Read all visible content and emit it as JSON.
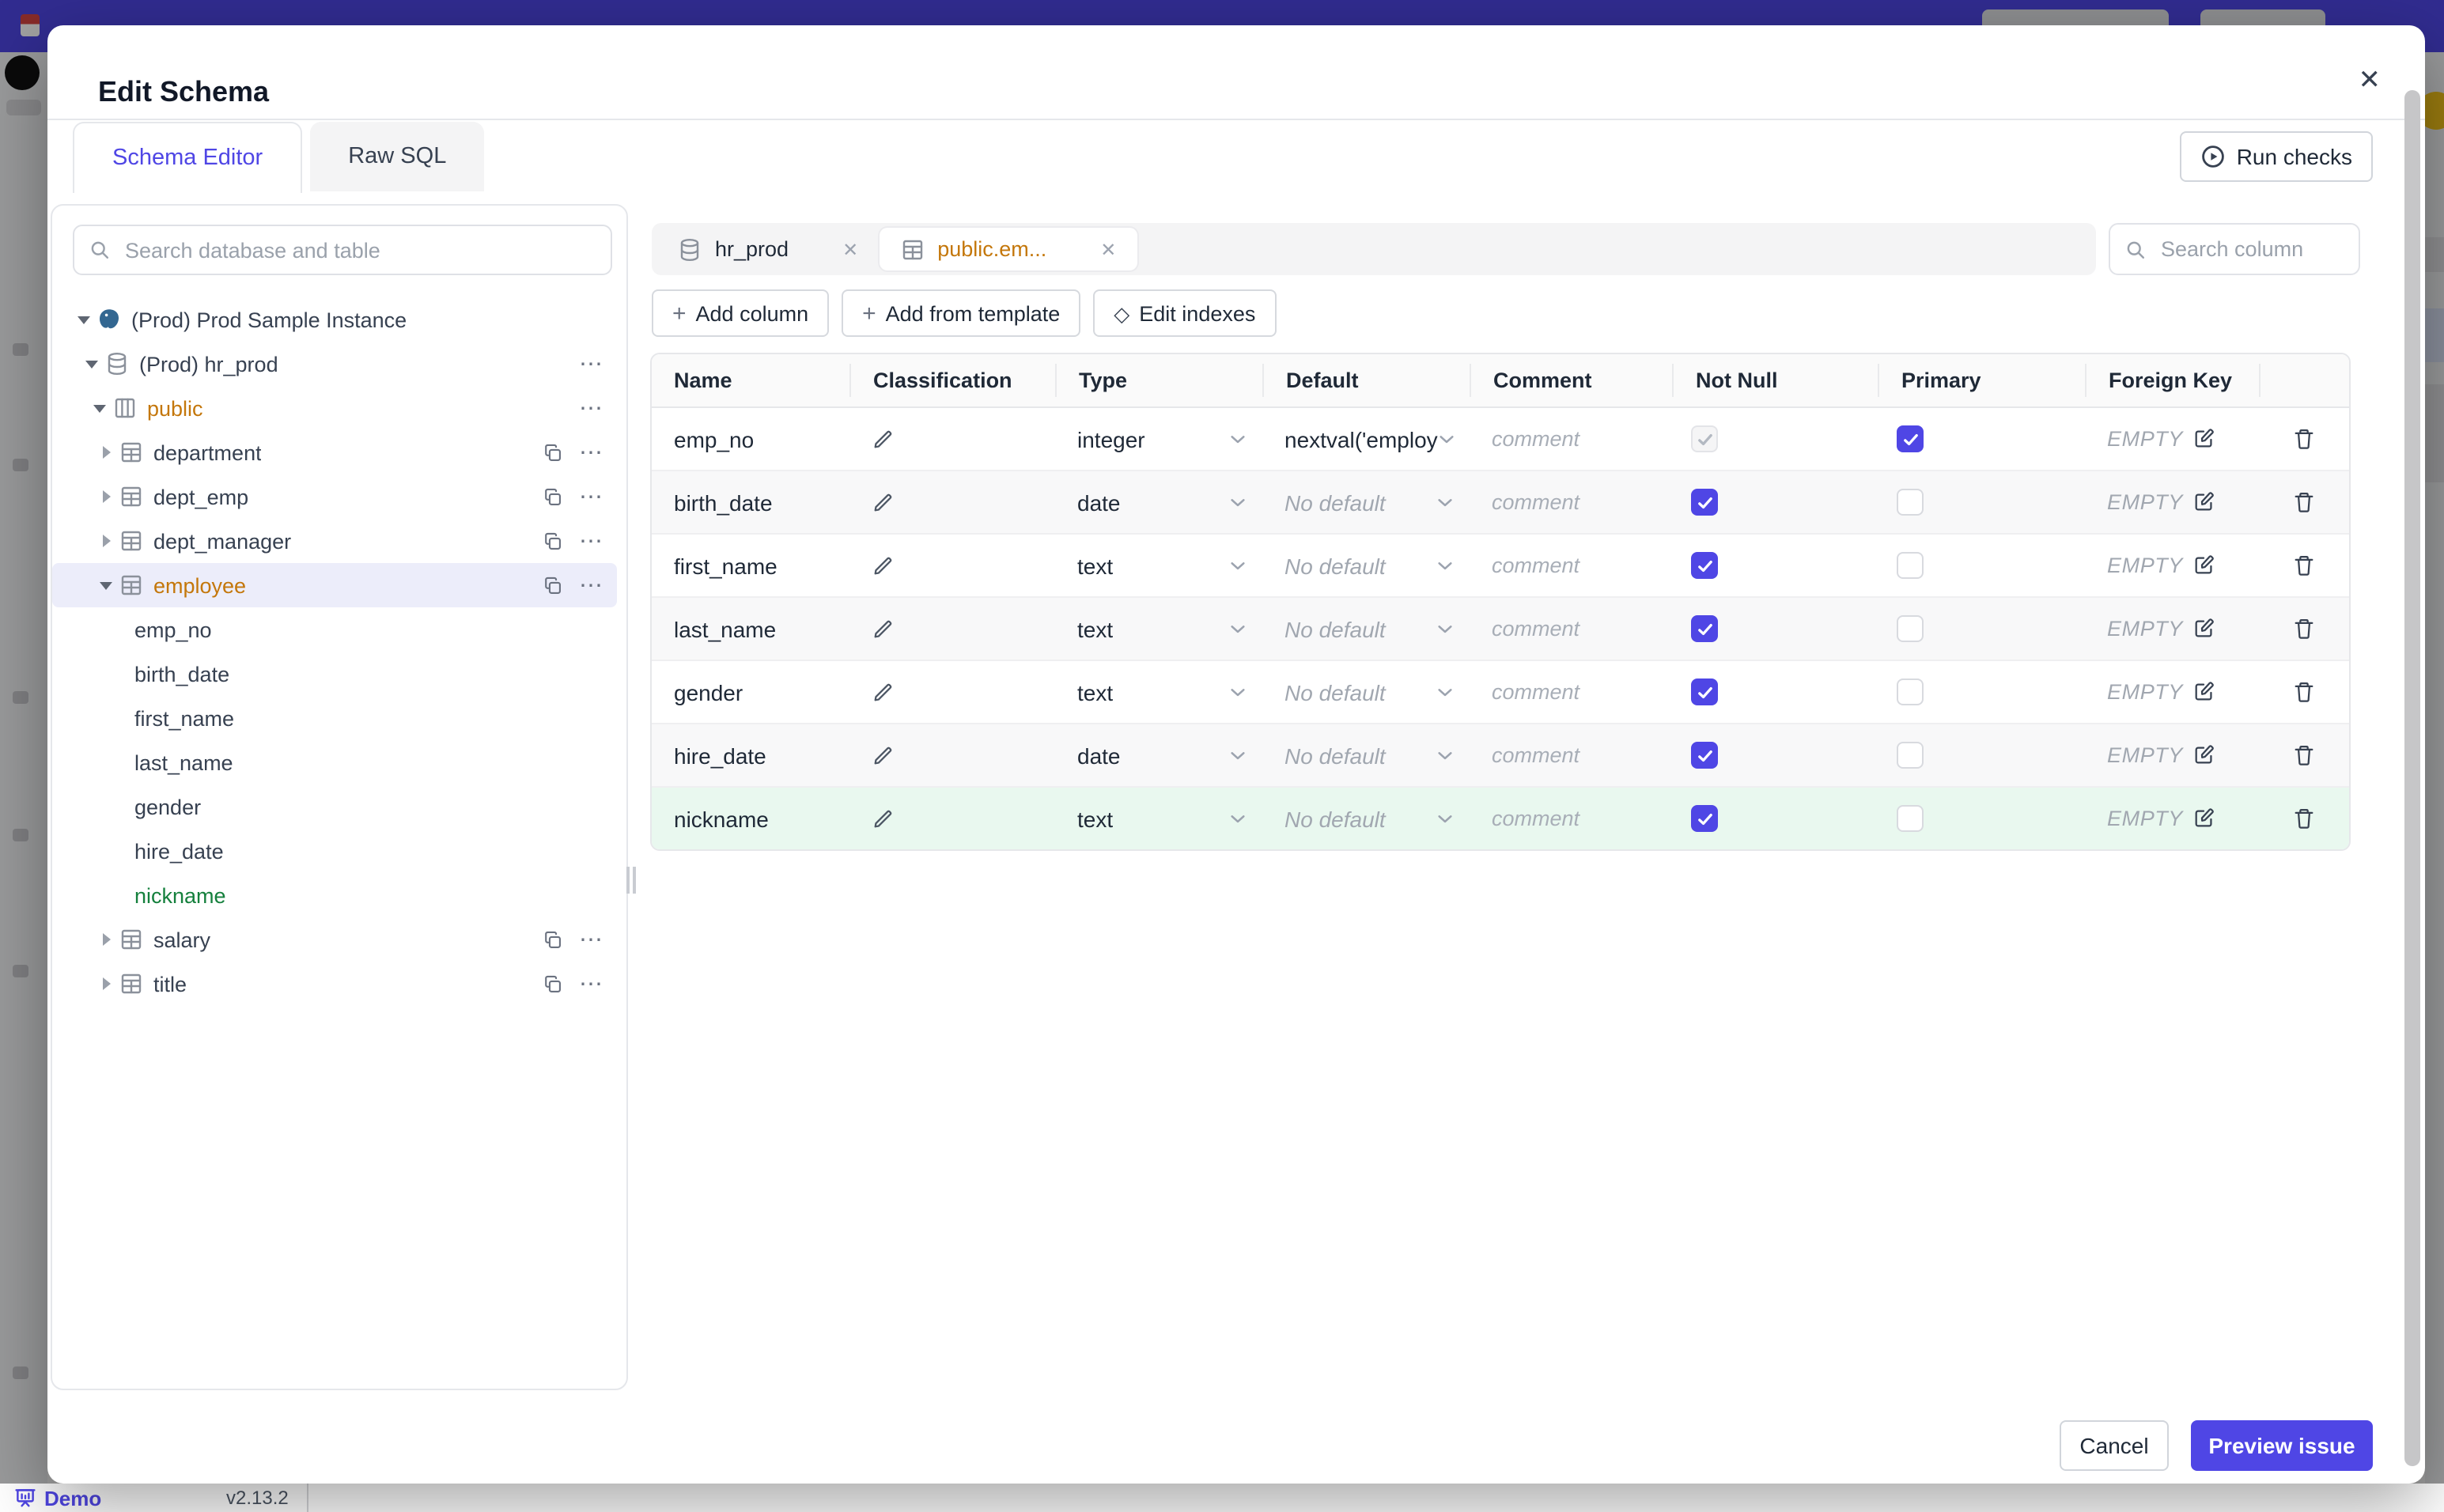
{
  "modal": {
    "title": "Edit Schema",
    "close_glyph": "✕",
    "tabs": [
      {
        "label": "Schema Editor",
        "active": true
      },
      {
        "label": "Raw SQL",
        "active": false
      }
    ],
    "run_checks_label": "Run checks",
    "tree_panel": {
      "search_placeholder": "Search database and table",
      "items": [
        {
          "label": "(Prod) Prod Sample Instance",
          "level": 0,
          "caret": "down",
          "icon": "postgres",
          "color": "",
          "selected": false,
          "actions": []
        },
        {
          "label": "(Prod) hr_prod",
          "level": 1,
          "caret": "down",
          "icon": "database",
          "color": "",
          "selected": false,
          "actions": [
            "menu"
          ]
        },
        {
          "label": "public",
          "level": 2,
          "caret": "down",
          "icon": "schema",
          "color": "amber",
          "selected": false,
          "actions": [
            "menu"
          ]
        },
        {
          "label": "department",
          "level": 3,
          "caret": "right",
          "icon": "table",
          "color": "",
          "selected": false,
          "actions": [
            "copy",
            "menu"
          ]
        },
        {
          "label": "dept_emp",
          "level": 3,
          "caret": "right",
          "icon": "table",
          "color": "",
          "selected": false,
          "actions": [
            "copy",
            "menu"
          ]
        },
        {
          "label": "dept_manager",
          "level": 3,
          "caret": "right",
          "icon": "table",
          "color": "",
          "selected": false,
          "actions": [
            "copy",
            "menu"
          ]
        },
        {
          "label": "employee",
          "level": 3,
          "caret": "down",
          "icon": "table",
          "color": "amber",
          "selected": true,
          "actions": [
            "copy",
            "menu"
          ]
        },
        {
          "label": "emp_no",
          "level": 4,
          "caret": null,
          "icon": null,
          "color": "",
          "selected": false,
          "actions": []
        },
        {
          "label": "birth_date",
          "level": 4,
          "caret": null,
          "icon": null,
          "color": "",
          "selected": false,
          "actions": []
        },
        {
          "label": "first_name",
          "level": 4,
          "caret": null,
          "icon": null,
          "color": "",
          "selected": false,
          "actions": []
        },
        {
          "label": "last_name",
          "level": 4,
          "caret": null,
          "icon": null,
          "color": "",
          "selected": false,
          "actions": []
        },
        {
          "label": "gender",
          "level": 4,
          "caret": null,
          "icon": null,
          "color": "",
          "selected": false,
          "actions": []
        },
        {
          "label": "hire_date",
          "level": 4,
          "caret": null,
          "icon": null,
          "color": "",
          "selected": false,
          "actions": []
        },
        {
          "label": "nickname",
          "level": 4,
          "caret": null,
          "icon": null,
          "color": "green",
          "selected": false,
          "actions": []
        },
        {
          "label": "salary",
          "level": 3,
          "caret": "right",
          "icon": "table",
          "color": "",
          "selected": false,
          "actions": [
            "copy",
            "menu"
          ]
        },
        {
          "label": "title",
          "level": 3,
          "caret": "right",
          "icon": "table",
          "color": "",
          "selected": false,
          "actions": [
            "copy",
            "menu"
          ]
        }
      ]
    },
    "editor": {
      "tabs": [
        {
          "label": "hr_prod",
          "icon": "database",
          "active": false,
          "color": ""
        },
        {
          "label": "public.em...",
          "icon": "table",
          "active": true,
          "color": "amber"
        }
      ],
      "toolbar": [
        {
          "icon": "plus",
          "label": "Add column"
        },
        {
          "icon": "plus",
          "label": "Add from template"
        },
        {
          "icon": "diamond",
          "label": "Edit indexes"
        }
      ],
      "search_placeholder": "Search column",
      "table": {
        "headers": [
          "Name",
          "Classification",
          "Type",
          "Default",
          "Comment",
          "Not Null",
          "Primary",
          "Foreign Key",
          ""
        ],
        "comment_placeholder": "comment",
        "rows": [
          {
            "name": "emp_no",
            "type": "integer",
            "default": "nextval('employ",
            "default_set": true,
            "not_null": "checked_disabled",
            "primary": "checked",
            "fk": "EMPTY",
            "variant": "plain"
          },
          {
            "name": "birth_date",
            "type": "date",
            "default": "No default",
            "default_set": false,
            "not_null": "checked",
            "primary": "unchecked",
            "fk": "EMPTY",
            "variant": "alt"
          },
          {
            "name": "first_name",
            "type": "text",
            "default": "No default",
            "default_set": false,
            "not_null": "checked",
            "primary": "unchecked",
            "fk": "EMPTY",
            "variant": "plain"
          },
          {
            "name": "last_name",
            "type": "text",
            "default": "No default",
            "default_set": false,
            "not_null": "checked",
            "primary": "unchecked",
            "fk": "EMPTY",
            "variant": "alt"
          },
          {
            "name": "gender",
            "type": "text",
            "default": "No default",
            "default_set": false,
            "not_null": "checked",
            "primary": "unchecked",
            "fk": "EMPTY",
            "variant": "plain"
          },
          {
            "name": "hire_date",
            "type": "date",
            "default": "No default",
            "default_set": false,
            "not_null": "checked",
            "primary": "unchecked",
            "fk": "EMPTY",
            "variant": "alt"
          },
          {
            "name": "nickname",
            "type": "text",
            "default": "No default",
            "default_set": false,
            "not_null": "checked",
            "primary": "unchecked",
            "fk": "EMPTY",
            "variant": "new"
          }
        ]
      }
    },
    "footer": {
      "cancel": "Cancel",
      "primary": "Preview issue"
    }
  },
  "statusbar": {
    "demo": "Demo",
    "version": "v2.13.2"
  },
  "icons": {
    "search": "magnifier",
    "close": "✕",
    "run_checks": "play-circle",
    "plus": "+",
    "diamond": "◇",
    "more_options": "⋯",
    "classification_edit": "pencil",
    "dropdown": "chevron-down",
    "foreign_key_edit": "pencil-square",
    "delete": "trash",
    "duplicate": "copy",
    "instance": "postgres-elephant",
    "database": "cylinder",
    "schema": "columns",
    "table": "grid",
    "demo": "presentation-board",
    "banner": "calendar"
  },
  "colors": {
    "accent": "#4f46e5",
    "amber": "#c4770b",
    "green": "#15803d",
    "green_row": "#e9f8ef",
    "selected_row": "#ecedfa",
    "banner": "#4f46e5"
  }
}
